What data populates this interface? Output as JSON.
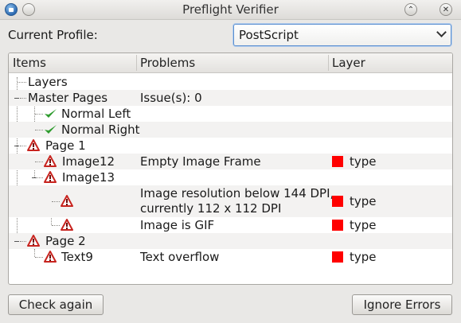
{
  "window": {
    "title": "Preflight Verifier"
  },
  "profile": {
    "label": "Current Profile:",
    "selected": "PostScript"
  },
  "columns": {
    "items": "Items",
    "problems": "Problems",
    "layer": "Layer"
  },
  "rows": [
    {
      "item": "Layers",
      "problem": "",
      "layer": ""
    },
    {
      "item": "Master Pages",
      "problem": "Issue(s): 0",
      "layer": ""
    },
    {
      "item": "Normal Left",
      "problem": "",
      "layer": ""
    },
    {
      "item": "Normal Right",
      "problem": "",
      "layer": ""
    },
    {
      "item": "Page 1",
      "problem": "",
      "layer": ""
    },
    {
      "item": "Image12",
      "problem": "Empty Image Frame",
      "layer": "type"
    },
    {
      "item": "Image13",
      "problem": "",
      "layer": ""
    },
    {
      "item": "",
      "problem_line1": "Image resolution below 144 DPI,",
      "problem_line2": "currently 112 x 112 DPI",
      "layer": "type"
    },
    {
      "item": "",
      "problem": "Image is GIF",
      "layer": "type"
    },
    {
      "item": "Page 2",
      "problem": "",
      "layer": ""
    },
    {
      "item": "Text9",
      "problem": "Text overflow",
      "layer": "type"
    }
  ],
  "colors": {
    "layer_swatch": "#ff0000",
    "warning_icon": "#c8241f",
    "ok_check": "#2f9c2f"
  },
  "icons": {
    "warning": "warning-triangle-icon",
    "ok": "checkmark-icon"
  },
  "buttons": {
    "check_again": "Check again",
    "ignore_errors": "Ignore Errors"
  }
}
